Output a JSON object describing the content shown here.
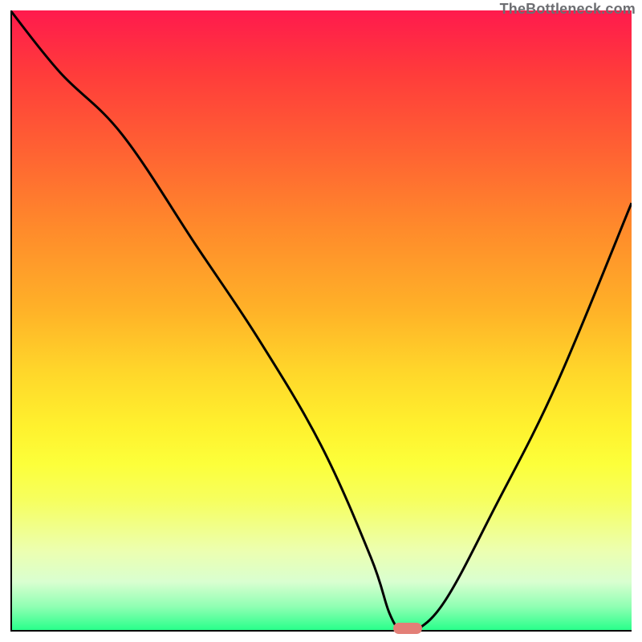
{
  "watermark": "TheBottleneck.com",
  "chart_data": {
    "type": "line",
    "title": "",
    "xlabel": "",
    "ylabel": "",
    "xlim": [
      0,
      100
    ],
    "ylim": [
      0,
      100
    ],
    "series": [
      {
        "name": "curve",
        "x": [
          0,
          8,
          18,
          30,
          40,
          50,
          58,
          61,
          63,
          65,
          70,
          78,
          88,
          100
        ],
        "y": [
          100,
          90,
          80,
          62,
          47,
          30,
          12,
          3,
          0,
          0,
          5,
          20,
          40,
          69
        ]
      }
    ],
    "marker": {
      "x": 64,
      "y": 0.5,
      "color": "#e37f77"
    },
    "background_gradient": {
      "top": "#ff1a4d",
      "mid": "#ffd62a",
      "bottom": "#22ff88"
    }
  }
}
